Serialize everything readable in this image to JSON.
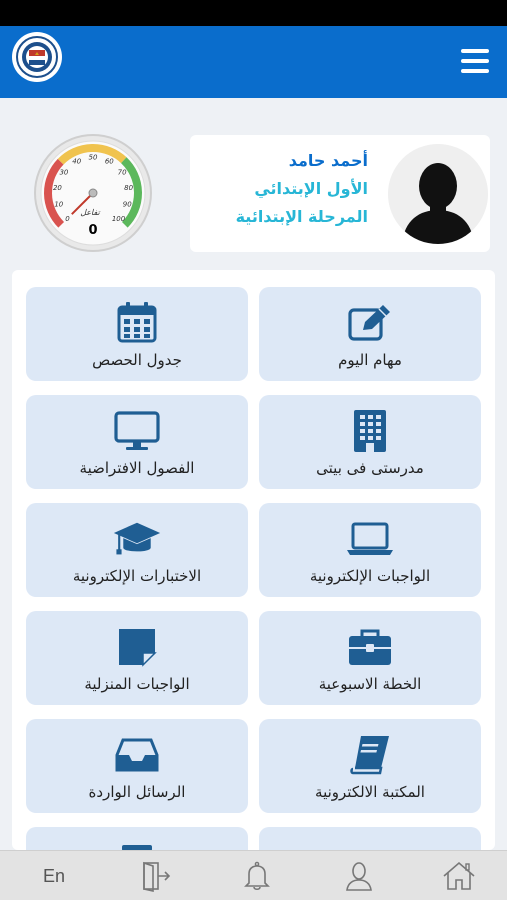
{
  "profile": {
    "name": "أحمد حامد",
    "grade": "الأول الإبتدائي",
    "stage": "المرحلة الإبتدائية"
  },
  "gauge": {
    "ticks": [
      "0",
      "10",
      "20",
      "30",
      "40",
      "50",
      "60",
      "70",
      "80",
      "90",
      "100"
    ],
    "caption": "تفاعل",
    "value_text": "0",
    "value": 0
  },
  "menu": {
    "items": [
      {
        "label": "مهام اليوم",
        "icon": "edit-icon"
      },
      {
        "label": "جدول الحصص",
        "icon": "calendar-icon"
      },
      {
        "label": "مدرستى فى بيتى",
        "icon": "building-icon"
      },
      {
        "label": "الفصول الافتراضية",
        "icon": "monitor-icon"
      },
      {
        "label": "الواجبات الإلكترونية",
        "icon": "laptop-icon"
      },
      {
        "label": "الاختبارات الإلكترونية",
        "icon": "graduation-cap-icon"
      },
      {
        "label": "الخطة الاسبوعية",
        "icon": "briefcase-icon"
      },
      {
        "label": "الواجبات المنزلية",
        "icon": "sticky-note-icon"
      },
      {
        "label": "المكتبة الالكترونية",
        "icon": "book-icon"
      },
      {
        "label": "الرسائل الواردة",
        "icon": "inbox-icon"
      }
    ]
  },
  "bottom_nav": {
    "language_label": "En"
  },
  "colors": {
    "header": "#0a6dcc",
    "tile": "#dde8f6",
    "icon": "#1f5e93",
    "name": "#0a6dcc",
    "sub": "#27b6d6"
  }
}
